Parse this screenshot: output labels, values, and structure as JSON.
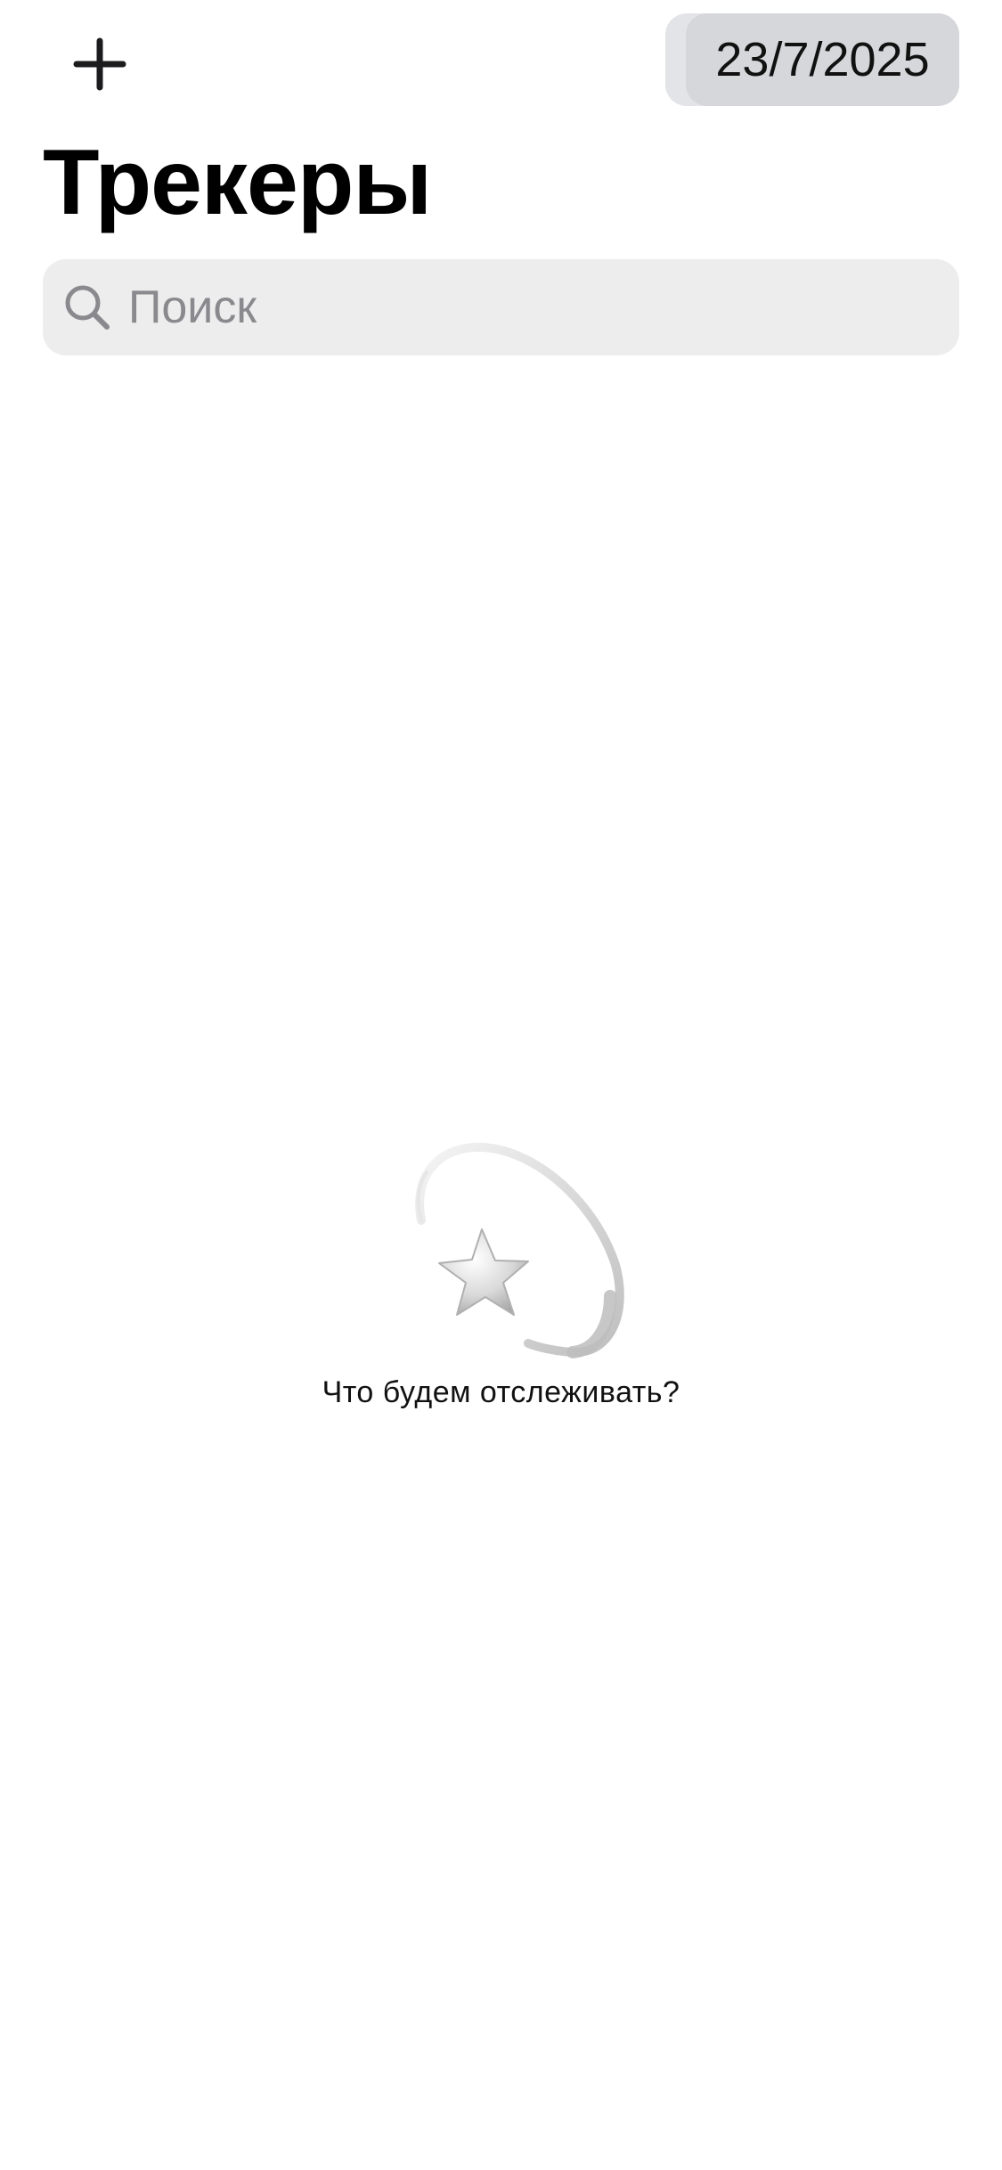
{
  "toolbar": {
    "add_icon": "plus-icon",
    "date": "23/7/2025"
  },
  "header": {
    "title": "Трекеры"
  },
  "search": {
    "icon": "magnifying-glass-icon",
    "placeholder": "Поиск",
    "value": ""
  },
  "empty_state": {
    "illustration": "shooting-star-icon",
    "message": "Что будем отслеживать?"
  },
  "colors": {
    "background": "#ffffff",
    "date_pill": "#d6d7db",
    "search_background": "#ededee",
    "placeholder": "#8a8a8e"
  }
}
